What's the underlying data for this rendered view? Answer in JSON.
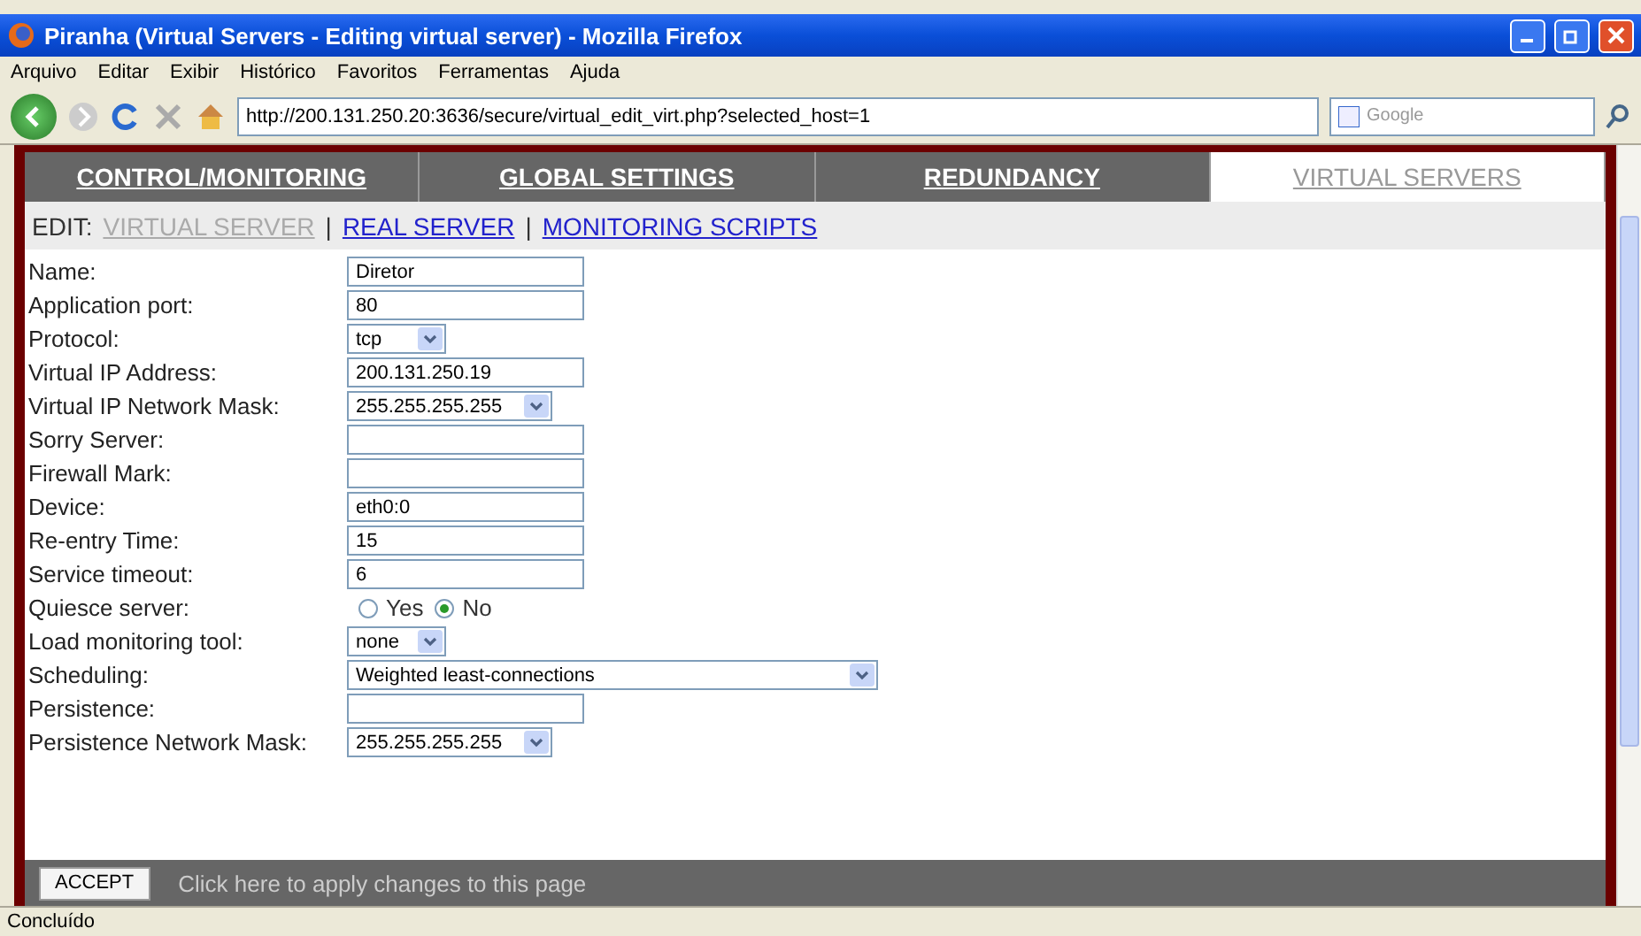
{
  "window": {
    "title": "Piranha (Virtual Servers - Editing virtual server) - Mozilla Firefox"
  },
  "menu": [
    "Arquivo",
    "Editar",
    "Exibir",
    "Histórico",
    "Favoritos",
    "Ferramentas",
    "Ajuda"
  ],
  "address_bar": {
    "value": "http://200.131.250.20:3636/secure/virtual_edit_virt.php?selected_host=1"
  },
  "search": {
    "placeholder": "Google"
  },
  "tabs": [
    {
      "label": "CONTROL/MONITORING",
      "selected": false
    },
    {
      "label": "GLOBAL SETTINGS",
      "selected": false
    },
    {
      "label": "REDUNDANCY",
      "selected": false
    },
    {
      "label": "VIRTUAL SERVERS",
      "selected": true
    }
  ],
  "subnav": {
    "prefix": "EDIT:",
    "separator": "|",
    "links": [
      {
        "label": "VIRTUAL SERVER",
        "selected": true
      },
      {
        "label": "REAL SERVER",
        "selected": false
      },
      {
        "label": "MONITORING SCRIPTS",
        "selected": false
      }
    ]
  },
  "fields": [
    {
      "kind": "text",
      "label": "Name:",
      "value": "Diretor"
    },
    {
      "kind": "text",
      "label": "Application port:",
      "value": "80"
    },
    {
      "kind": "select",
      "label": "Protocol:",
      "value": "tcp"
    },
    {
      "kind": "text",
      "label": "Virtual IP Address:",
      "value": "200.131.250.19"
    },
    {
      "kind": "select",
      "label": "Virtual IP Network Mask:",
      "value": "255.255.255.255"
    },
    {
      "kind": "text",
      "label": "Sorry Server:"
    },
    {
      "kind": "text",
      "label": "Firewall Mark:"
    },
    {
      "kind": "text",
      "label": "Device:",
      "value": "eth0:0"
    },
    {
      "kind": "text",
      "label": "Re-entry Time:",
      "value": "15"
    },
    {
      "kind": "text",
      "label": "Service timeout:",
      "value": "6"
    },
    {
      "kind": "radio",
      "label": "Quiesce server:",
      "options": [
        {
          "label": "Yes",
          "selected": false
        },
        {
          "label": "No",
          "selected": true
        }
      ]
    },
    {
      "kind": "select",
      "label": "Load monitoring tool:",
      "value": "none"
    },
    {
      "kind": "select",
      "label": "Scheduling:",
      "value": "Weighted least-connections",
      "wide": true
    },
    {
      "kind": "text",
      "label": "Persistence:"
    },
    {
      "kind": "select",
      "label": "Persistence Network Mask:",
      "value": "255.255.255.255"
    }
  ],
  "accept": {
    "button": "ACCEPT",
    "text": "Click here to apply changes to this page"
  },
  "status_bar": {
    "text": "Concluído"
  }
}
